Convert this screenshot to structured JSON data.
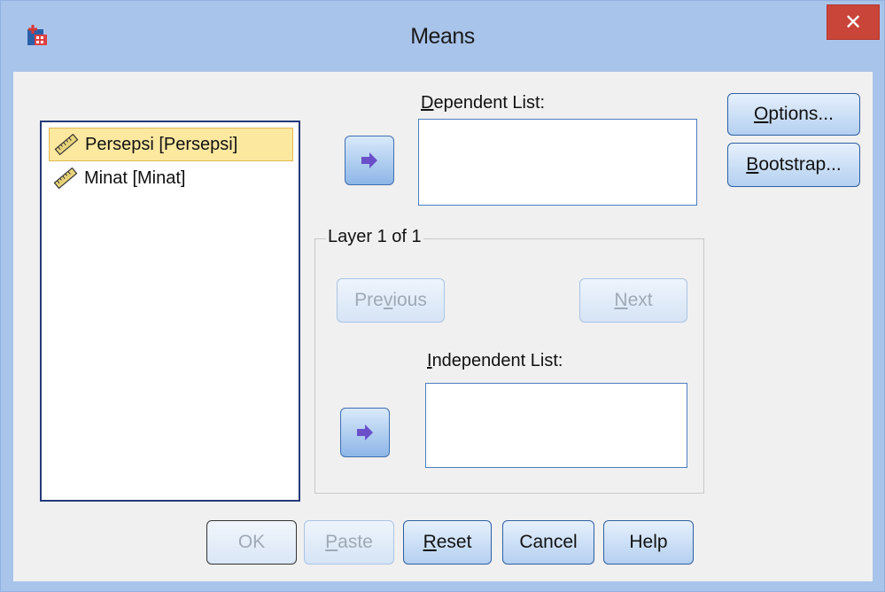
{
  "window": {
    "title": "Means",
    "close_glyph": "✕"
  },
  "variables": [
    {
      "name": "Persepsi [Persepsi]",
      "icon": "ruler-scale-icon",
      "selected": true
    },
    {
      "name": "Minat [Minat]",
      "icon": "ruler-scale-icon",
      "selected": false
    }
  ],
  "dependent": {
    "label_mnemonic": "D",
    "label_rest": "ependent List:"
  },
  "layer": {
    "title": "Layer 1 of 1",
    "previous_label_pre": "Pre",
    "previous_label_mnemonic": "v",
    "previous_label_post": "ious",
    "next_label_mnemonic": "N",
    "next_label_rest": "ext"
  },
  "independent": {
    "label_mnemonic": "I",
    "label_rest": "ndependent List:"
  },
  "side_buttons": {
    "options_mnemonic": "O",
    "options_rest": "ptions...",
    "bootstrap_mnemonic": "B",
    "bootstrap_rest": "ootstrap..."
  },
  "bottom_buttons": {
    "ok": "OK",
    "paste_mnemonic": "P",
    "paste_rest": "aste",
    "reset_mnemonic": "R",
    "reset_rest": "eset",
    "cancel": "Cancel",
    "help": "Help"
  },
  "colors": {
    "frame": "#a9c4ea",
    "close": "#c9453a",
    "selection": "#fde8a0"
  }
}
